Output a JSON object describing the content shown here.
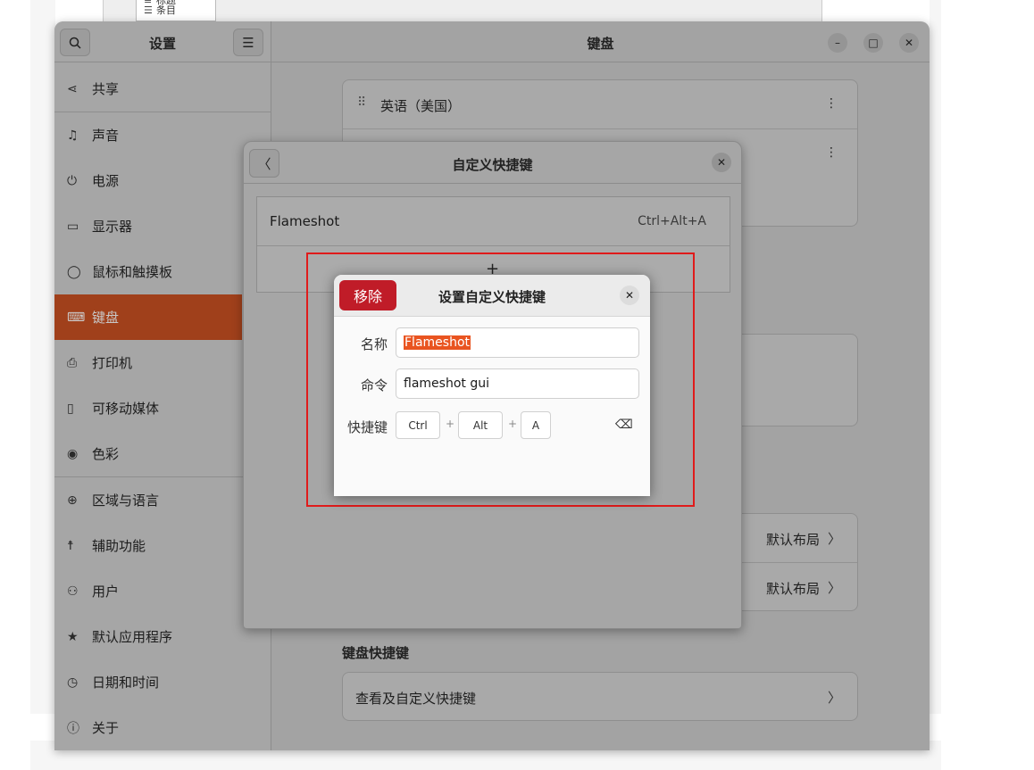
{
  "background": {
    "menu_items": [
      {
        "icon": "text-icon",
        "label": "标题"
      },
      {
        "icon": "list-icon",
        "label": "条目"
      }
    ]
  },
  "sidebar": {
    "title": "设置",
    "items": [
      {
        "label": "共享",
        "icon": "share-icon"
      },
      {
        "label": "声音",
        "icon": "music-note-icon"
      },
      {
        "label": "电源",
        "icon": "power-icon"
      },
      {
        "label": "显示器",
        "icon": "display-icon"
      },
      {
        "label": "鼠标和触摸板",
        "icon": "mouse-icon"
      },
      {
        "label": "键盘",
        "icon": "keyboard-icon",
        "active": true
      },
      {
        "label": "打印机",
        "icon": "printer-icon"
      },
      {
        "label": "可移动媒体",
        "icon": "removable-media-icon"
      },
      {
        "label": "色彩",
        "icon": "color-icon"
      },
      {
        "label": "区域与语言",
        "icon": "globe-icon"
      },
      {
        "label": "辅助功能",
        "icon": "accessibility-icon"
      },
      {
        "label": "用户",
        "icon": "user-icon"
      },
      {
        "label": "默认应用程序",
        "icon": "star-icon"
      },
      {
        "label": "日期和时间",
        "icon": "clock-icon"
      },
      {
        "label": "关于",
        "icon": "info-icon"
      }
    ]
  },
  "main": {
    "title": "键盘",
    "input_sources": [
      "英语（美国）"
    ],
    "layout_rows": [
      "默认布局",
      "默认布局"
    ],
    "shortcuts_heading": "键盘快捷键",
    "view_shortcuts": "查看及自定义快捷键"
  },
  "custom_dialog": {
    "title": "自定义快捷键",
    "shortcuts": [
      {
        "name": "Flameshot",
        "accel": "Ctrl+Alt+A"
      }
    ],
    "add_symbol": "+"
  },
  "set_dialog": {
    "remove_label": "移除",
    "title": "设置自定义快捷键",
    "name_label": "名称",
    "name_value": "Flameshot",
    "command_label": "命令",
    "command_value": "flameshot gui",
    "shortcut_label": "快捷键",
    "keys": [
      "Ctrl",
      "Alt",
      "A"
    ],
    "key_separator": "+"
  },
  "colors": {
    "accent": "#e95420",
    "sidebar_active": "#a0401b",
    "remove": "#c01c28",
    "highlight": "#e01b1b"
  }
}
